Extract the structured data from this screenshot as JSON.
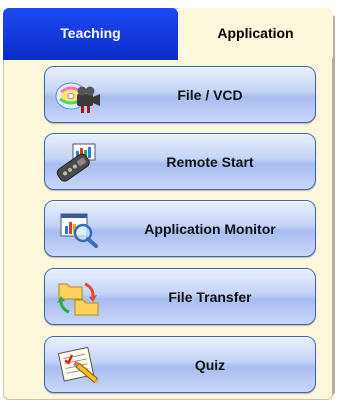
{
  "tabs": {
    "teaching": "Teaching",
    "application": "Application",
    "active": "Application"
  },
  "buttons": [
    {
      "label": "File / VCD",
      "icon": "vcd-camera-icon"
    },
    {
      "label": "Remote Start",
      "icon": "remote-start-icon"
    },
    {
      "label": "Application Monitor",
      "icon": "application-monitor-icon"
    },
    {
      "label": "File Transfer",
      "icon": "file-transfer-icon"
    },
    {
      "label": "Quiz",
      "icon": "quiz-icon"
    }
  ],
  "colors": {
    "tab_active_bg": "#0a2fc9",
    "panel_bg": "#fdf7dc",
    "button_border": "#3b64b6"
  }
}
